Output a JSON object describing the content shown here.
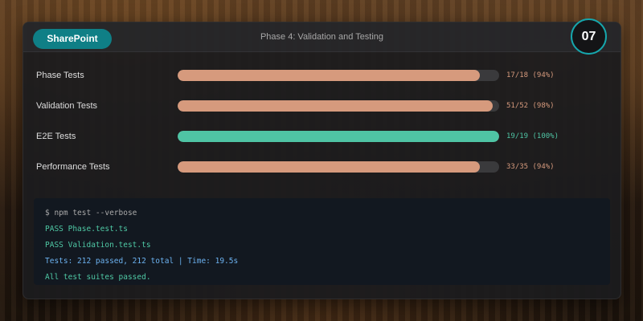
{
  "header": {
    "brand_label": "SharePoint",
    "title": "Phase 4: Validation and Testing",
    "step_number": "07"
  },
  "metrics": [
    {
      "label": "Phase Tests",
      "value_text": "17/18 (94%)",
      "fraction": 0.94,
      "color": "#d69a7d"
    },
    {
      "label": "Validation Tests",
      "value_text": "51/52 (98%)",
      "fraction": 0.98,
      "color": "#d69a7d"
    },
    {
      "label": "E2E Tests",
      "value_text": "19/19 (100%)",
      "fraction": 1.0,
      "color": "#4fc4a4"
    },
    {
      "label": "Performance Tests",
      "value_text": "33/35 (94%)",
      "fraction": 0.94,
      "color": "#d69a7d"
    }
  ],
  "terminal": {
    "lines": [
      {
        "text": "$ npm test --verbose",
        "color": "#a9a9a9"
      },
      {
        "text": "PASS Phase.test.ts",
        "color": "#4fc9a5"
      },
      {
        "text": "PASS Validation.test.ts",
        "color": "#4fc9a5"
      },
      {
        "text": "Tests: 212 passed, 212 total | Time: 19.5s",
        "color": "#6cb2f0"
      },
      {
        "text": "All test suites passed.",
        "color": "#4fc9a5"
      }
    ]
  }
}
